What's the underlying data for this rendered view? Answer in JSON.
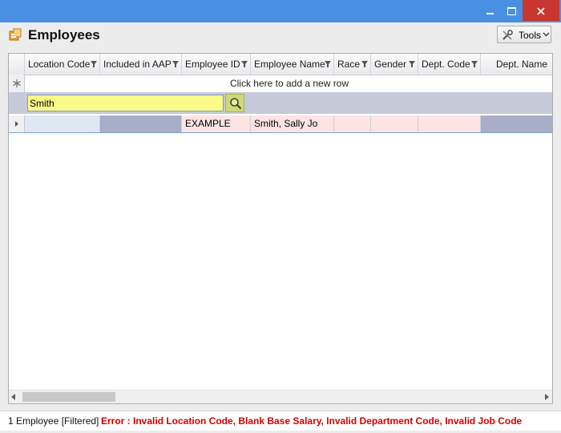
{
  "window": {
    "minimize_icon": "minimize-icon",
    "maximize_icon": "maximize-icon",
    "close_icon": "close-icon",
    "accent_color": "#4a90e2",
    "close_color": "#c7372f"
  },
  "header": {
    "title": "Employees",
    "tools_label": "Tools"
  },
  "grid": {
    "columns": [
      {
        "label": "Location Code",
        "filter": true
      },
      {
        "label": "Included in AAP",
        "filter": true
      },
      {
        "label": "Employee ID",
        "filter": true
      },
      {
        "label": "Employee Name",
        "filter": true
      },
      {
        "label": "Race",
        "filter": true
      },
      {
        "label": "Gender",
        "filter": true
      },
      {
        "label": "Dept. Code",
        "filter": true
      },
      {
        "label": "Dept. Name",
        "filter": false
      }
    ],
    "new_row_text": "Click here to add a new row",
    "search": {
      "value": "Smith",
      "placeholder": ""
    },
    "rows": [
      {
        "location_code": "",
        "included_in_aap": "",
        "employee_id": "EXAMPLE",
        "employee_name": "Smith, Sally Jo",
        "race": "",
        "gender": "",
        "dept_code": "",
        "dept_name": ""
      }
    ],
    "highlight_colors": {
      "selected": "#dfe8f2",
      "gray": "#a8aec8",
      "error": "#fde4e4",
      "search_bg": "#fbfb8a"
    }
  },
  "status": {
    "count_text": "1 Employee [Filtered]",
    "error_text": "Error : Invalid Location Code, Blank Base Salary, Invalid Department Code, Invalid Job Code",
    "error_color": "#d40000"
  }
}
